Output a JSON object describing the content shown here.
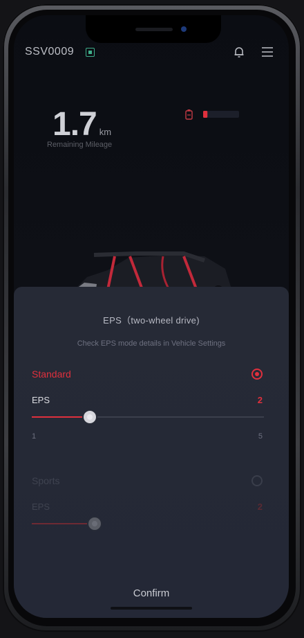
{
  "header": {
    "vehicle_id": "SSV0009",
    "signal_icon": "signal-icon",
    "bell_icon": "bell-icon",
    "menu_icon": "menu-icon"
  },
  "dashboard": {
    "range_value": "1.7",
    "range_unit": "km",
    "range_label": "Remaining Mileage",
    "battery_icon": "battery-icon",
    "battery_level": 0.12,
    "accent_color": "#e0303d"
  },
  "sheet": {
    "title": "EPS（two-wheel drive)",
    "subtitle": "Check EPS mode details in Vehicle Settings",
    "modes": [
      {
        "name": "Standard",
        "selected": true,
        "param_label": "EPS",
        "value": "2",
        "min": "1",
        "max": "5",
        "level": 2
      },
      {
        "name": "Sports",
        "selected": false,
        "param_label": "EPS",
        "value": "2",
        "level": 2
      }
    ],
    "confirm_label": "Confirm"
  }
}
